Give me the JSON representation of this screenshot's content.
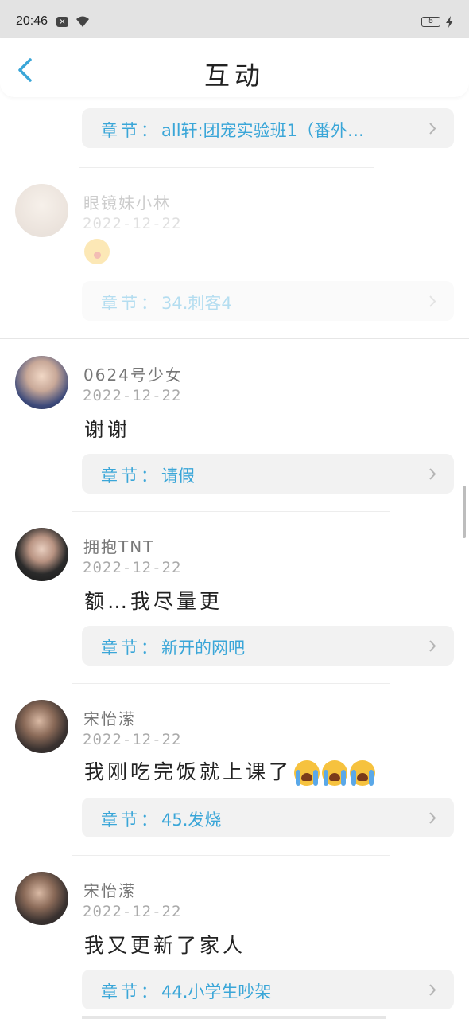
{
  "status_bar": {
    "time": "20:46",
    "battery": "5"
  },
  "header": {
    "title": "互动"
  },
  "chapter_prefix": "章节：",
  "top_chapter": "all轩:团宠实验班1（番外…",
  "comments": [
    {
      "username": "眼镜妹小林",
      "date": "2022-12-22",
      "content": "",
      "emoji": "kiss-emoji",
      "chapter": "34.刺客4"
    },
    {
      "username": "0624号少女",
      "date": "2022-12-22",
      "content": "谢谢",
      "chapter": "请假"
    },
    {
      "username": "拥抱TNT",
      "date": "2022-12-22",
      "content": "额…我尽量更",
      "chapter": "新开的网吧"
    },
    {
      "username": "宋怡潆",
      "date": "2022-12-22",
      "content": "我刚吃完饭就上课了",
      "emoji": "crying-emoji",
      "chapter": "45.发烧"
    },
    {
      "username": "宋怡潆",
      "date": "2022-12-22",
      "content": "我又更新了家人",
      "chapter": "44.小学生吵架"
    }
  ],
  "colors": {
    "accent": "#3aa6d8",
    "status_bg": "#e3e3e3",
    "chip_bg": "#f2f2f2"
  }
}
